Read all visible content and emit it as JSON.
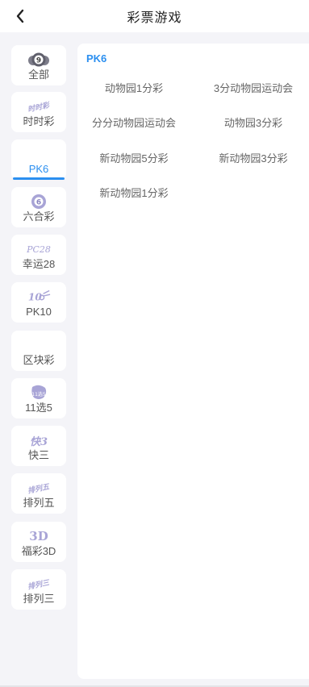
{
  "header": {
    "title": "彩票游戏"
  },
  "sidebar": {
    "items": [
      {
        "label": "全部",
        "icon": "lottery-ball-9-icon",
        "icon_text": "9"
      },
      {
        "label": "时时彩",
        "icon": "ssc-logo-icon",
        "icon_text": "时时彩"
      },
      {
        "label": "PK6",
        "icon": "",
        "icon_text": "",
        "active": true
      },
      {
        "label": "六合彩",
        "icon": "lottery-ball-6-icon",
        "icon_text": "6"
      },
      {
        "label": "幸运28",
        "icon": "pc28-logo-icon",
        "icon_text": "PC28"
      },
      {
        "label": "PK10",
        "icon": "pk10-logo-icon",
        "icon_text": "10"
      },
      {
        "label": "区块彩",
        "icon": "",
        "icon_text": ""
      },
      {
        "label": "11选5",
        "icon": "11x5-logo-icon",
        "icon_text": "11选5"
      },
      {
        "label": "快三",
        "icon": "k3-logo-icon",
        "icon_text": "快3"
      },
      {
        "label": "排列五",
        "icon": "pl5-logo-icon",
        "icon_text": "排列五"
      },
      {
        "label": "福彩3D",
        "icon": "3d-logo-icon",
        "icon_text": "3D"
      },
      {
        "label": "排列三",
        "icon": "pl3-logo-icon",
        "icon_text": "排列三"
      }
    ]
  },
  "content": {
    "section_title": "PK6",
    "games": [
      "动物园1分彩",
      "3分动物园运动会",
      "分分动物园运动会",
      "动物园3分彩",
      "新动物园5分彩",
      "新动物园3分彩",
      "新动物园1分彩"
    ]
  },
  "colors": {
    "accent": "#2b8ff0",
    "icon": "#a8a4d6",
    "bg": "#f4f4f8"
  }
}
